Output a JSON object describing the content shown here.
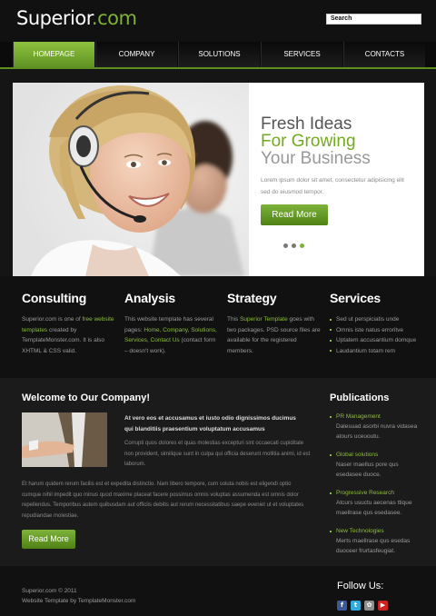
{
  "header": {
    "logo_main": "Superior",
    "logo_accent": ".com",
    "search_value": "Search"
  },
  "nav": {
    "items": [
      "HOMEPAGE",
      "COMPANY",
      "SOLUTIONS",
      "SERVICES",
      "CONTACTS"
    ]
  },
  "hero": {
    "line1": "Fresh Ideas",
    "line2": "For Growing",
    "line3": "Your Business",
    "desc": "Lorem ipsum dolor sit amet, consectetur adipisicing elit sed do eiusmod tempor.",
    "button": "Read More"
  },
  "features": {
    "consulting": {
      "title": "Consulting",
      "p1": "Superior.com is one of ",
      "link": "free website templates",
      "p2": " created by TemplateMonster.com. It is also XHTML & CSS valid."
    },
    "analysis": {
      "title": "Analysis",
      "p1": "This website template has several pages: ",
      "links": "Home, Company, Solutions, Services, Contact Us",
      "p2": " (contact form – doesn't work)."
    },
    "strategy": {
      "title": "Strategy",
      "p1": "This ",
      "link": "Superior Template",
      "p2": " goes with two packages. PSD source files are available for the registered members."
    },
    "services": {
      "title": "Services",
      "items": [
        "Sed ut perspiciatis unde",
        "Omnis iste natus erroritve",
        "Uptatem accusantium domque",
        "Laudantium totam rem"
      ]
    }
  },
  "welcome": {
    "title": "Welcome to Our Company!",
    "bold": "At vero eos et accusamus et iusto odio dignissimos ducimus qui blanditiis praesentium voluptatum accusamus",
    "small": "Corrupti quos dolores et quas molestias excepturi sint occaecati cupiditate non provident, similique sunt in culpa qui officia deserunt mollitia animi, id est laborum.",
    "para": "Et harum quidem rerum facilis est et expedita distinctio. Nam libero tempore, cum soluta nobis est eligendi optio cumque nihil impedit quo minus quod maxime placeat facere possimus omnis voluptas assumenda est omnis dolor repellendus. Temporibus autem quibusdam aut officiis debitis aut rerum necessitatibus saepe eveniet ut et voluptates repudiandae molestiae.",
    "button": "Read More"
  },
  "publications": {
    "title": "Publications",
    "items": [
      {
        "title": "PR Management",
        "desc": "Dalesuad asorbi nuvra vidasea atours uceuoutu."
      },
      {
        "title": "Global solutions",
        "desc": "Naser maellus pore qus esedasee duoce."
      },
      {
        "title": "Progressive Research",
        "desc": "Atcurs usuctu aecenas ttique maellrase qus esedasee."
      },
      {
        "title": "New Technologies",
        "desc": "Merts maellrase qus esedas duoceer frurtasfeugiat."
      }
    ]
  },
  "footer": {
    "copyright": "Superior.com © 2011",
    "credit": "Website Template by TemplateMonster.com",
    "follow": "Follow Us:",
    "social": [
      {
        "name": "facebook-icon",
        "glyph": "f",
        "color": "#3b5998"
      },
      {
        "name": "twitter-icon",
        "glyph": "t",
        "color": "#33aadd"
      },
      {
        "name": "picasa-icon",
        "glyph": "✿",
        "color": "#8e8e8e"
      },
      {
        "name": "youtube-icon",
        "glyph": "▶",
        "color": "#cc2222"
      }
    ]
  },
  "colors": {
    "accent": "#7eb33a",
    "background": "#151515"
  }
}
